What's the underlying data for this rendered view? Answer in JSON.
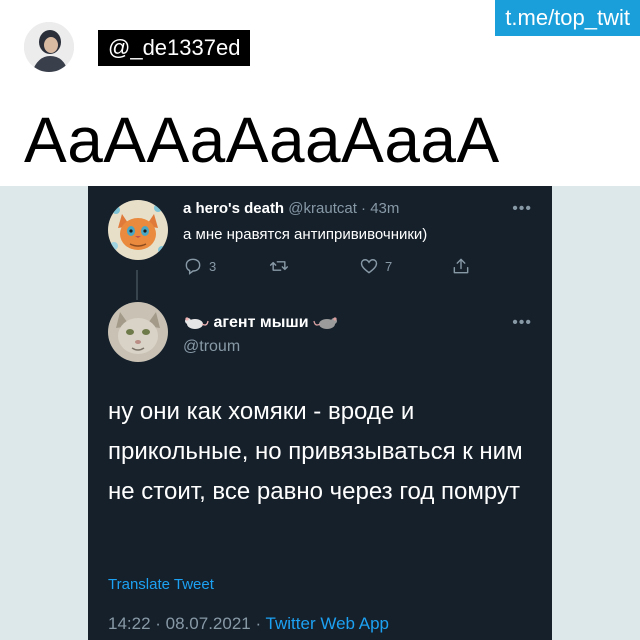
{
  "channel_badge": "t.me/top_twit",
  "poster_handle": "@_de1337ed",
  "caption": "AaAAaAaaAaaA",
  "quoted_thread": {
    "reply": {
      "name": "a hero's death",
      "handle_time": "@krautcat · 43m",
      "text": "а мне нравятся антипрививочники)",
      "more": "•••",
      "actions": {
        "reply_count": "3",
        "retweet_count": "",
        "like_count": "7",
        "share_count": ""
      }
    },
    "main": {
      "name": "агент мыши",
      "handle": "@troum",
      "more": "•••",
      "text": "ну они как хомяки - вроде и прикольные, но привязываться к ним не стоит, все равно через год помрут",
      "translate": "Translate Tweet",
      "timestamp": "14:22 · 08.07.2021 · ",
      "app": "Twitter Web App"
    }
  },
  "icons": [
    "reply-icon",
    "retweet-icon",
    "like-icon",
    "share-icon",
    "rat-icon",
    "cat-avatar",
    "person-avatar"
  ],
  "colors": {
    "badge_bg": "#1a9fda",
    "tweet_bg": "#15202b",
    "link_blue": "#1da1f2",
    "muted": "#8899a6",
    "band_bg": "#dce8ea"
  }
}
